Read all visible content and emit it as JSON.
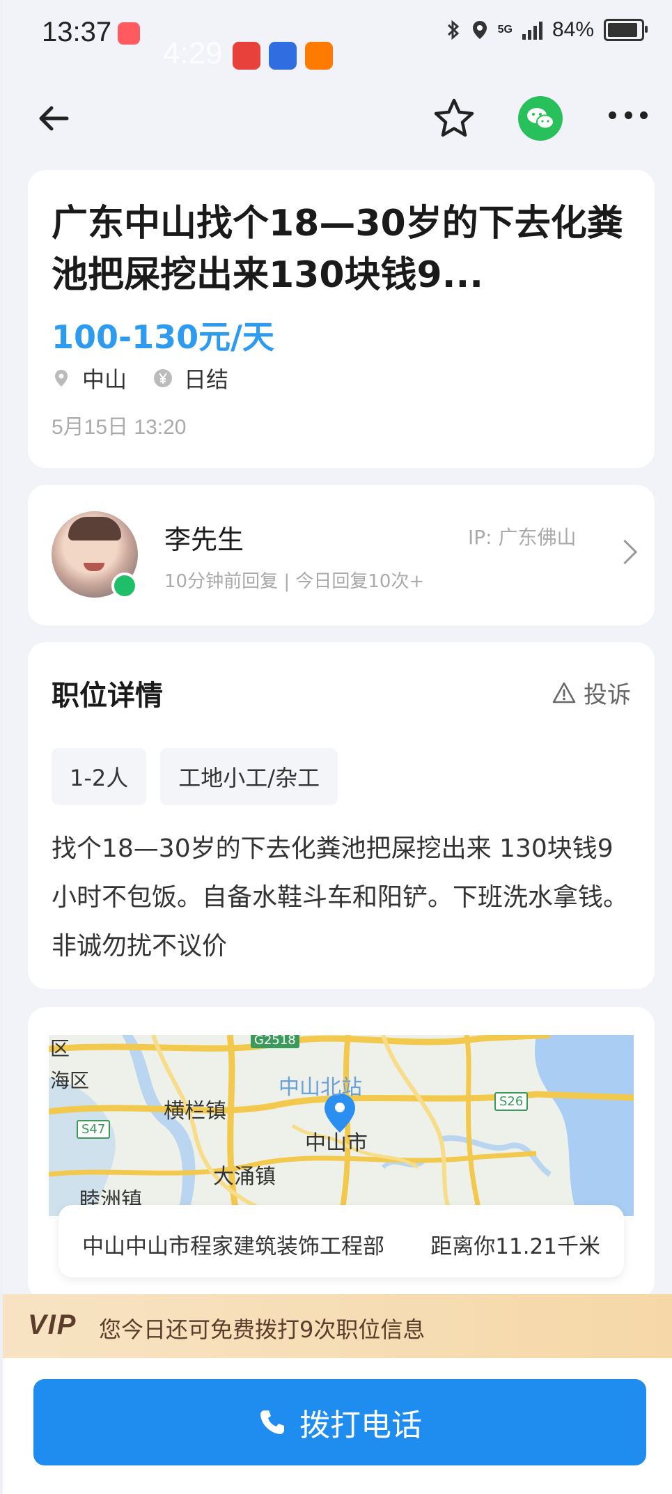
{
  "status_bar": {
    "time": "13:37",
    "ghost_time": "4:29",
    "network": "5G",
    "battery": "84%"
  },
  "job": {
    "title": "广东中山找个18—30岁的下去化粪池把屎挖出来130块钱9...",
    "wage": "100-130元/天",
    "location": "中山",
    "payment": "日结",
    "date": "5月15日 13:20"
  },
  "employer": {
    "name": "李先生",
    "reply_info": "10分钟前回复 | 今日回复10次+",
    "ip": "IP:  广东佛山"
  },
  "details": {
    "section_title": "职位详情",
    "report_label": "投诉",
    "tags": [
      "1-2人",
      "工地小工/杂工"
    ],
    "description": "找个18—30岁的下去化粪池把屎挖出来 130块钱9小时不包饭。自备水鞋斗车和阳铲。下班洗水拿钱。非诚勿扰不议价"
  },
  "map": {
    "labels": {
      "haiqu": "区",
      "haiqu2": "海区",
      "north_station": "中山北站",
      "henglan": "横栏镇",
      "city": "中山市",
      "datong": "大涌镇",
      "shazhou": "睦洲镇",
      "g2518": "G2518",
      "s47": "S47",
      "s26": "S26"
    },
    "address": "中山中山市程家建筑装饰工程部",
    "distance": "距离你11.21千米"
  },
  "vip": {
    "logo": "VIP",
    "text": "您今日还可免费拨打9次职位信息"
  },
  "call_button": "拨打电话"
}
